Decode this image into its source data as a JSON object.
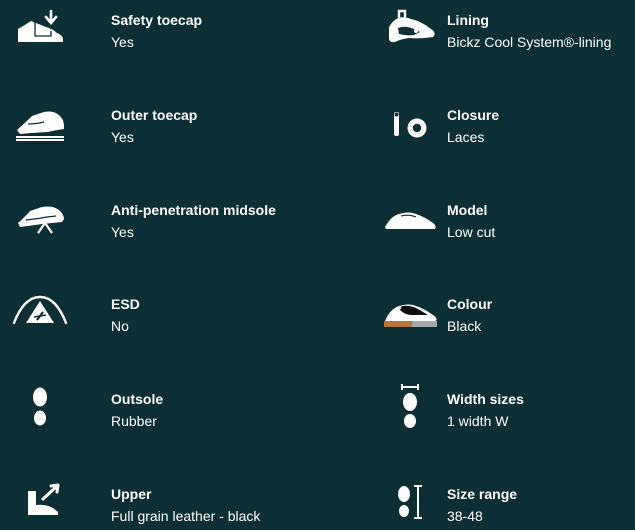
{
  "features": [
    {
      "label": "Safety toecap",
      "value": "Yes",
      "icon": "safety-toecap-icon"
    },
    {
      "label": "Lining",
      "value": "Bickz Cool System®-lining",
      "icon": "lining-icon"
    },
    {
      "label": "Outer toecap",
      "value": "Yes",
      "icon": "outer-toecap-icon"
    },
    {
      "label": "Closure",
      "value": "Laces",
      "icon": "closure-icon"
    },
    {
      "label": "Anti-penetration midsole",
      "value": "Yes",
      "icon": "midsole-icon"
    },
    {
      "label": "Model",
      "value": "Low cut",
      "icon": "model-icon"
    },
    {
      "label": "ESD",
      "value": "No",
      "icon": "esd-icon"
    },
    {
      "label": "Colour",
      "value": "Black",
      "icon": "colour-icon"
    },
    {
      "label": "Outsole",
      "value": "Rubber",
      "icon": "outsole-icon"
    },
    {
      "label": "Width sizes",
      "value": "1 width W",
      "icon": "width-sizes-icon"
    },
    {
      "label": "Upper",
      "value": "Full grain leather - black",
      "icon": "upper-icon"
    },
    {
      "label": "Size range",
      "value": "38-48",
      "icon": "size-range-icon"
    }
  ],
  "colors": {
    "background": "#0b2f35",
    "text": "#ffffff",
    "accent_brown": "#b8743c",
    "accent_gray": "#a7a7a7"
  }
}
